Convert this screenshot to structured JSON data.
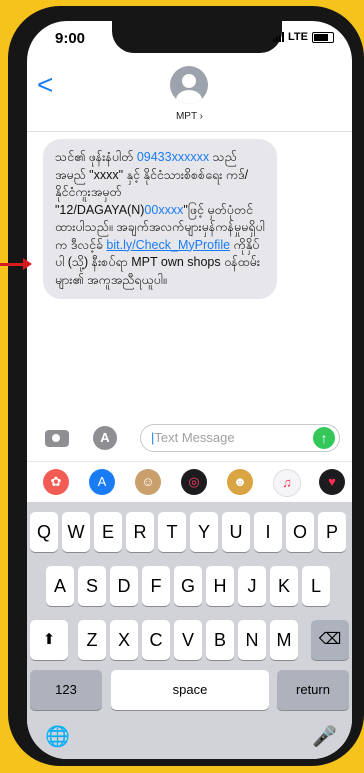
{
  "status_bar": {
    "time": "9:00",
    "network": "LTE"
  },
  "header": {
    "back_symbol": "<",
    "contact_name": "MPT ›"
  },
  "message": {
    "seg1": "သင်၏ ဖုန်းနံပါတ် ",
    "phone": "09433xxxxxx",
    "seg2": " သည် အမည် \"xxxx\" နှင့် နိုင်ငံသားစိစစ်ရေး ကဒ်/နိုင်ငံကူးအမှတ် \"12/DAGAYA(N)",
    "id_tail": "00xxxx",
    "seg3": "\"ဖြင့် မှတ်ပုံတင်ထားပါသည်။ အချက်အလက်များမှန်ကန်မှုမရှိပါက ဒီလင့်ခ် ",
    "link": "bit.ly/Check_MyProfile",
    "seg4": " ကိုနှိပ်ပါ (သို့) နီးစပ်ရာ MPT own shops ဝန်ထမ်းများ၏ အကူအညီရယူပါ။"
  },
  "composer": {
    "placeholder": "Text Message",
    "send_symbol": "↑",
    "app_symbol": "A"
  },
  "app_strip": {
    "icons": [
      {
        "name": "photos-icon",
        "color": "#f25c54",
        "glyph": "✿"
      },
      {
        "name": "app-store-icon",
        "color": "#1a7cf4",
        "glyph": "A"
      },
      {
        "name": "memoji-icon",
        "color": "#c9a06b",
        "glyph": "☺"
      },
      {
        "name": "activity-icon",
        "color": "#1c1c1e",
        "glyph": "◎"
      },
      {
        "name": "animoji-icon",
        "color": "#d9a441",
        "glyph": "☻"
      },
      {
        "name": "music-icon",
        "color": "#f5f5f7",
        "glyph": "♫"
      },
      {
        "name": "heart-icon",
        "color": "#1c1c1e",
        "glyph": "♥"
      }
    ]
  },
  "keyboard": {
    "row1": [
      "Q",
      "W",
      "E",
      "R",
      "T",
      "Y",
      "U",
      "I",
      "O",
      "P"
    ],
    "row2": [
      "A",
      "S",
      "D",
      "F",
      "G",
      "H",
      "J",
      "K",
      "L"
    ],
    "row3": [
      "Z",
      "X",
      "C",
      "V",
      "B",
      "N",
      "M"
    ],
    "shift": "⬆",
    "delete": "⌫",
    "numbers": "123",
    "space": "space",
    "return": "return",
    "globe": "🌐",
    "mic": "🎤"
  }
}
